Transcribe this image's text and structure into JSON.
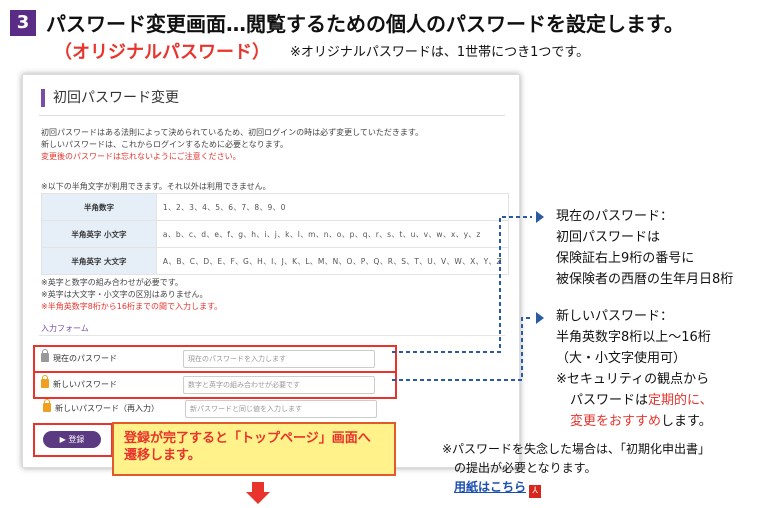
{
  "header": {
    "step_number": "3",
    "title": "パスワード変更画面…閲覧するための個人のパスワードを設定します。",
    "subtitle": "（オリジナルパスワード）",
    "note": "※オリジナルパスワードは、1世帯につき1つです。"
  },
  "screen": {
    "title": "初回パスワード変更",
    "intro_lines": [
      "初回パスワードはある法則によって決められているため、初回ログインの時は必ず変更していただきます。",
      "新しいパスワードは、これからログインするために必要となります。"
    ],
    "intro_warning": "変更後のパスワードは忘れないようにご注意ください。",
    "char_note": "※以下の半角文字が利用できます。それ以外は利用できません。",
    "char_table": [
      {
        "label": "半角数字",
        "value": "1、2、3、4、5、6、7、8、9、0"
      },
      {
        "label": "半角英字 小文字",
        "value": "a、b、c、d、e、f、g、h、i、j、k、l、m、n、o、p、q、r、s、t、u、v、w、x、y、z"
      },
      {
        "label": "半角英字 大文字",
        "value": "A、B、C、D、E、F、G、H、I、J、K、L、M、N、O、P、Q、R、S、T、U、V、W、X、Y、Z"
      }
    ],
    "rules": [
      "※英字と数字の組み合わせが必要です。",
      "※英字は大文字・小文字の区別はありません。"
    ],
    "rule_warning": "※半角英数字8桁から16桁までの間で入力します。",
    "form_section": "入力フォーム",
    "fields": {
      "current": {
        "label": "現在のパスワード",
        "placeholder": "現在のパスワードを入力します"
      },
      "new": {
        "label": "新しいパスワード",
        "placeholder": "数字と英字の組み合わせが必要です"
      },
      "confirm": {
        "label": "新しいパスワード（再入力）",
        "placeholder": "新パスワードと同じ値を入力します"
      }
    },
    "register_button": "登録"
  },
  "callout": {
    "line1": "登録が完了すると「トップページ」画面へ",
    "line2": "遷移します。"
  },
  "annotations": {
    "current": {
      "heading": "現在のパスワード：",
      "lines": [
        "初回パスワードは",
        "保険証右上9桁の番号に",
        "被保険者の西暦の生年月日8桁"
      ]
    },
    "new": {
      "heading": "新しいパスワード：",
      "line1": "半角英数字8桁以上～16桁",
      "line2": "（大・小文字使用可）",
      "line3": "※セキュリティの観点から",
      "line4_pre": "パスワードは",
      "line4_red": "定期的に、",
      "line5_red": "変更をおすすめ",
      "line5_post": "します。"
    },
    "bottom_note": {
      "line1": "※パスワードを失念した場合は、「初期化申出書」",
      "line2": "の提出が必要となります。",
      "link": "用紙はこちら"
    }
  },
  "colors": {
    "accent": "#5b2c86",
    "highlight": "#e8342c",
    "callout_bg": "#fff28a",
    "link": "#1a4fb0"
  }
}
